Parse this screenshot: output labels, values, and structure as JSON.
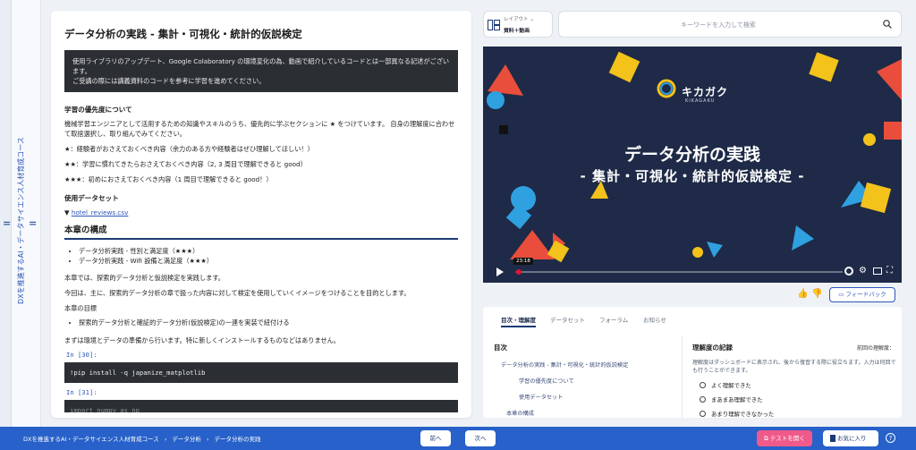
{
  "sidebar": {
    "course_title": "DXを推進するAI・データサイエンス人材育成コース",
    "grip_icon": "="
  },
  "article": {
    "title": "データ分析の実践 - 集計・可視化・統計的仮説検定",
    "notice_line1": "使用ライブラリのアップデート、Google Colaboratory の環境変化の為、動画で紹介しているコードとは一部異なる記述がございます。",
    "notice_line2": "ご受講の際には講義資料のコードを参考に学習を進めてください。",
    "priority_heading": "学習の優先度について",
    "priority_text": "機械学習エンジニアとして活用するための知識やスキルのうち、優先的に学ぶセクションに ★ をつけています。 自身の理解度に合わせて取捨選択し、取り組んでみてください。",
    "star1": "★：経験者がおさえておくべき内容（余力のある方や経験者はぜひ理解してほしい！）",
    "star2": "★★：学習に慣れてきたらおさえておくべき内容（2, 3 周目で理解できると good）",
    "star3": "★★★：初めにおさえておくべき内容（1 周目で理解できると good！）",
    "dataset_heading": "使用データセット",
    "dataset_link": "hotel_reviews.csv",
    "dataset_arrow": "▼",
    "structure_heading": "本章の構成",
    "bullets": [
      "データ分析実践 - 性別と満足度（★★★）",
      "データ分析実践 - Wifi 設備と満足度（★★★）"
    ],
    "para1": "本章では、探索的データ分析と仮説検定を実践します。",
    "para2": "今回は、主に、探索的データ分析の章で扱った内容に対して検定を使用していくイメージをつけることを目的とします。",
    "goal_heading": "本章の目標",
    "goal_bullet": "探索的データ分析と確証的データ分析(仮説検定)の一連を実装で紐付ける",
    "para3": "まずは環境とデータの準備から行います。特に新しくインストールするものなどはありません。",
    "cell1_label": "In [30]:",
    "cell1_code": "!pip install -q japanize_matplotlib",
    "cell2_label": "In [31]:",
    "cell2_code": "import numpy as np"
  },
  "layout": {
    "label": "レイアウト ⌄",
    "value": "資料＋動画"
  },
  "search": {
    "placeholder": "キーワードを入力して検索"
  },
  "video": {
    "brand": "キカガク",
    "brand_sub": "KIKAGAKU",
    "title": "データ分析の実践",
    "subtitle": "- 集計・可視化・統計的仮説検定 -",
    "time": "23:18",
    "progress": 0.01
  },
  "feedback": {
    "label": "フィードバック"
  },
  "tabs": [
    "目次・理解度",
    "データセット",
    "フォーラム",
    "お知らせ"
  ],
  "toc": {
    "heading": "目次",
    "items": [
      "データ分析の実践 - 集計・可視化・統計的仮説検定",
      "学習の優先度について",
      "使用データセット",
      "本章の構成"
    ]
  },
  "understanding": {
    "heading": "理解度の記録",
    "previous": "前回の理解度：",
    "desc": "理解度はダッシュボードに表示され、後から復習する際に役立ちます。入力は何回でも行うことができます。",
    "options": [
      "よく理解できた",
      "まあまあ理解できた",
      "あまり理解できなかった"
    ]
  },
  "bottom": {
    "crumb1": "DXを推進するAI・データサイエンス人材育成コース",
    "crumb2": "データ分析",
    "crumb3": "データ分析の実践",
    "sep": "›",
    "prev": "前へ",
    "next": "次へ",
    "test": "テストを開く",
    "favorite": "お気に入り",
    "help": "?"
  },
  "colors": {
    "accent": "#2761c9",
    "navy": "#1c3a75",
    "test": "#f05a8a",
    "video_bg": "#1e2a47"
  }
}
